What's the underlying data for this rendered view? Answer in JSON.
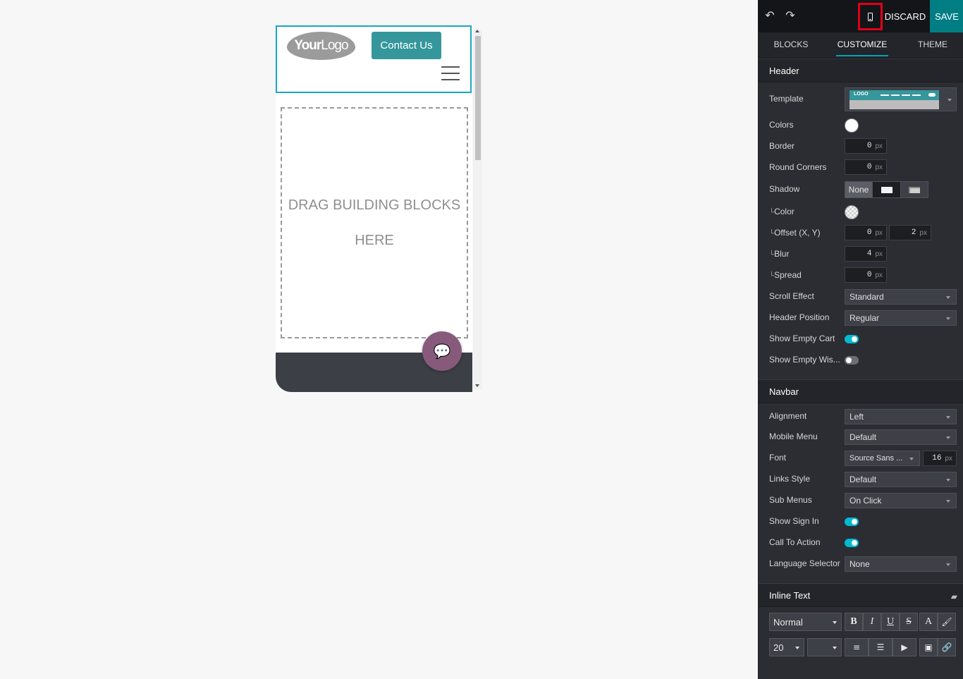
{
  "canvas": {
    "logo": {
      "bold": "Your",
      "light": "Logo"
    },
    "contact_button": "Contact Us",
    "dropzone": {
      "line1": "DRAG BUILDING BLOCKS",
      "line2": "HERE"
    }
  },
  "toolbar": {
    "discard": "DISCARD",
    "save": "SAVE",
    "icons": [
      "undo-icon",
      "redo-icon",
      "mobile-preview-icon"
    ]
  },
  "tabs": [
    {
      "label": "BLOCKS",
      "active": false
    },
    {
      "label": "CUSTOMIZE",
      "active": true
    },
    {
      "label": "THEME",
      "active": false
    }
  ],
  "header_section": {
    "title": "Header",
    "template_label": "Template",
    "template_preview_logo": "LOGO",
    "colors_label": "Colors",
    "border": {
      "label": "Border",
      "value": "0",
      "unit": "px"
    },
    "round_corners": {
      "label": "Round Corners",
      "value": "0",
      "unit": "px"
    },
    "shadow": {
      "label": "Shadow",
      "options": [
        "None",
        "outset-shadow-icon",
        "inset-shadow-icon"
      ],
      "selected": "None"
    },
    "shadow_color": {
      "label": "Color"
    },
    "offset": {
      "label": "Offset (X, Y)",
      "x": "0",
      "y": "2",
      "unit": "px"
    },
    "blur": {
      "label": "Blur",
      "value": "4",
      "unit": "px"
    },
    "spread": {
      "label": "Spread",
      "value": "0",
      "unit": "px"
    },
    "scroll_effect": {
      "label": "Scroll Effect",
      "value": "Standard"
    },
    "header_position": {
      "label": "Header Position",
      "value": "Regular"
    },
    "show_empty_cart": {
      "label": "Show Empty Cart",
      "on": true
    },
    "show_empty_wishlist": {
      "label": "Show Empty Wis...",
      "on": false
    }
  },
  "navbar_section": {
    "title": "Navbar",
    "alignment": {
      "label": "Alignment",
      "value": "Left"
    },
    "mobile_menu": {
      "label": "Mobile Menu",
      "value": "Default"
    },
    "font": {
      "label": "Font",
      "value": "Source Sans ...",
      "size": "16",
      "unit": "px"
    },
    "links_style": {
      "label": "Links Style",
      "value": "Default"
    },
    "sub_menus": {
      "label": "Sub Menus",
      "value": "On Click"
    },
    "show_sign_in": {
      "label": "Show Sign In",
      "on": true
    },
    "call_to_action": {
      "label": "Call To Action",
      "on": true
    },
    "language_selector": {
      "label": "Language Selector",
      "value": "None"
    }
  },
  "inline_text": {
    "title": "Inline Text",
    "style_select": "Normal",
    "size_select": "20",
    "font_select": "",
    "format_buttons": [
      "B",
      "I",
      "U",
      "S",
      "A"
    ]
  },
  "colors": {
    "accent": "#01bad2",
    "save": "#017e84",
    "contact_button": "#35979c",
    "chat_button": "#875a7b",
    "highlight_border": "#e0001b"
  }
}
